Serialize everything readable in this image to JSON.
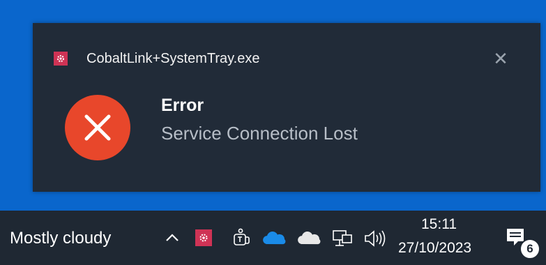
{
  "toast": {
    "app_name": "CobaltLink+SystemTray.exe",
    "close_glyph": "✕",
    "title": "Error",
    "message": "Service Connection Lost",
    "icons": {
      "app": "cobaltlink-app-icon",
      "status": "error-icon",
      "close": "close-icon"
    },
    "colors": {
      "background": "#212b38",
      "error": "#e8472b",
      "app_accent": "#cf3355"
    }
  },
  "taskbar": {
    "weather": "Mostly cloudy",
    "tray_icons": [
      "chevron-up-icon",
      "cobaltlink-tray-icon",
      "teams-icon",
      "onedrive-blue-icon",
      "onedrive-white-icon",
      "network-icon",
      "volume-icon"
    ],
    "clock": {
      "time": "15:11",
      "date": "27/10/2023"
    },
    "notification_count": "6",
    "colors": {
      "background": "#1f2833"
    }
  },
  "desktop": {
    "colors": {
      "background": "#0a66cc"
    }
  }
}
